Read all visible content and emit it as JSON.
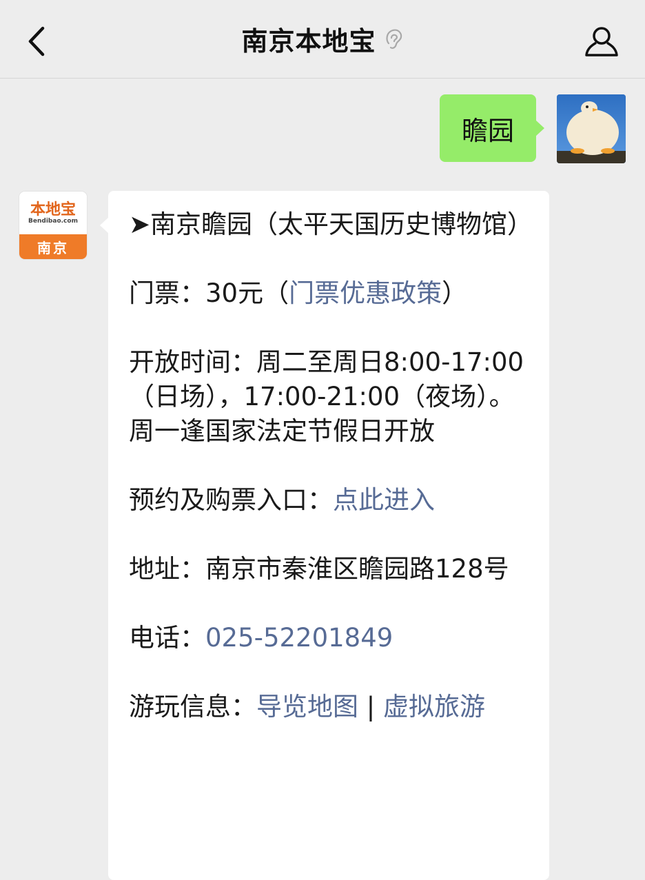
{
  "nav": {
    "title": "南京本地宝"
  },
  "outgoing": {
    "text": "瞻园"
  },
  "bot_logo": {
    "top_text": "本地宝",
    "sub_text": "Bendibao.com",
    "city": "南京"
  },
  "message": {
    "title": "➤南京瞻园（太平天国历史博物馆）",
    "ticket_label": "门票：30元（",
    "ticket_link": "门票优惠政策",
    "ticket_close": "）",
    "hours": "开放时间：周二至周日8:00-17:00（日场），17:00-21:00（夜场）。周一逢国家法定节假日开放",
    "booking_label": "预约及购票入口：",
    "booking_link": "点此进入",
    "address": "地址：南京市秦淮区瞻园路128号",
    "phone_label": "电话：",
    "phone_value": "025-52201849",
    "tour_label": "游玩信息：",
    "tour_link_1": "导览地图",
    "tour_sep": " | ",
    "tour_link_2": "虚拟旅游"
  },
  "colors": {
    "link": "#576b95",
    "outgoing_bubble": "#95ec69",
    "background": "#ededed",
    "brand_orange": "#ef7b28"
  },
  "icons": {
    "back": "chevron-left-icon",
    "ear": "ear-icon",
    "profile": "person-icon"
  }
}
